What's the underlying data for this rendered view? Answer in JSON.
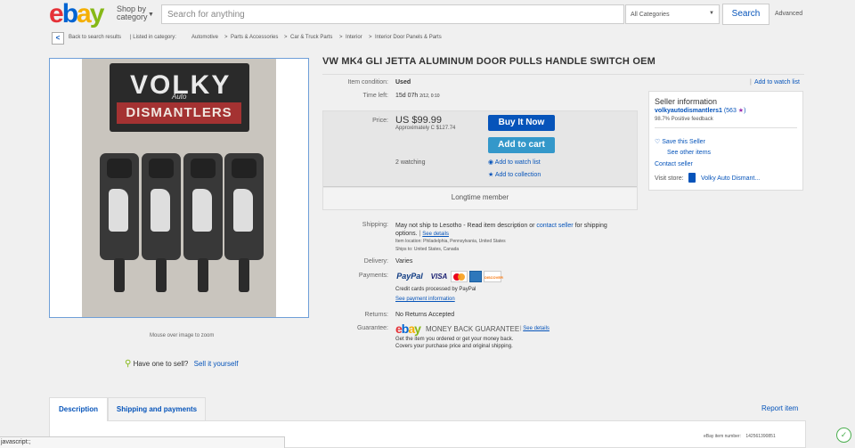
{
  "header": {
    "logo": [
      "e",
      "b",
      "a",
      "y"
    ],
    "shop_by": "Shop by",
    "category": "category",
    "search_placeholder": "Search for anything",
    "category_select": "All Categories",
    "search_button": "Search",
    "advanced": "Advanced"
  },
  "breadcrumb": {
    "back": "Back to search results",
    "listed_in": "| Listed in category:",
    "items": [
      "Automotive",
      "Parts & Accessories",
      "Car & Truck Parts",
      "Interior",
      "Interior Door Panels & Parts"
    ],
    "sep": ">"
  },
  "gallery": {
    "plate_top": "VOLKY",
    "plate_script": "Auto",
    "plate_bottom": "DISMANTLERS",
    "zoom_hint": "Mouse over image to zoom",
    "have_one": "Have one to sell?",
    "sell_it": "Sell it yourself"
  },
  "item": {
    "title": "VW MK4 GLI JETTA ALUMINUM DOOR PULLS HANDLE SWITCH OEM",
    "watch_list_top": "Add to watch list",
    "condition_label": "Item condition:",
    "condition": "Used",
    "time_left_label": "Time left:",
    "time_left": "15d 07h",
    "time_left_detail": "2/12, 0:10",
    "price_label": "Price:",
    "price": "US $99.99",
    "approx": "Approximately C $127.74",
    "buy_it_now": "Buy It Now",
    "add_to_cart": "Add to cart",
    "watching": "2 watching",
    "add_watch": "Add to watch list",
    "add_collection": "Add to collection",
    "longtime": "Longtime member",
    "shipping_label": "Shipping:",
    "shipping_text": "May not ship to Lesotho - Read item description or",
    "contact_seller": "contact seller",
    "shipping_tail": "for shipping",
    "options": "options.",
    "see_details": "See details",
    "item_location": "Item location:  Philadelphia, Pennsylvania, United States",
    "ships_to": "Ships to:  United States, Canada",
    "delivery_label": "Delivery:",
    "delivery": "Varies",
    "payments_label": "Payments:",
    "paypal": "PayPal",
    "visa": "VISA",
    "discover": "DISCOVER",
    "credit_cards": "Credit cards processed by PayPal",
    "see_payment": "See payment information",
    "returns_label": "Returns:",
    "returns": "No Returns Accepted",
    "guarantee_label": "Guarantee:",
    "guarantee_title": "MONEY BACK GUARANTEE",
    "guarantee_see": "See details",
    "guarantee_line1": "Get the item you ordered or get your money back.",
    "guarantee_line2": "Covers your purchase price and original shipping."
  },
  "seller": {
    "heading": "Seller information",
    "name": "volkyautodismantlers1",
    "feedback_open": "(563",
    "feedback_close": ")",
    "positive": "98.7% Positive feedback",
    "save": "Save this Seller",
    "other_items": "See other items",
    "contact": "Contact seller",
    "visit_store": "Visit store:",
    "store_name": "Volky Auto Dismant..."
  },
  "tabs": {
    "description": "Description",
    "shipping": "Shipping and payments",
    "report": "Report item",
    "item_number": "eBay item number:",
    "item_number_val": "142561390851"
  },
  "status_bar": "javascript:;",
  "colors": {
    "accent": "#0654ba",
    "buy_button": "#0654ba",
    "cart_button": "#3498ca"
  }
}
